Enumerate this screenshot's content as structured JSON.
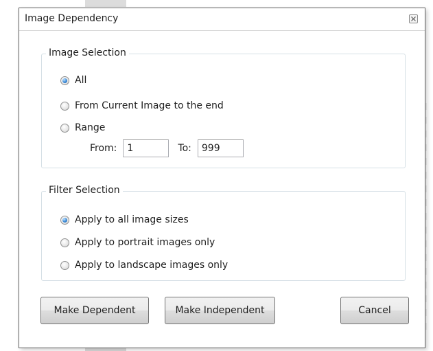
{
  "dialog": {
    "title": "Image Dependency"
  },
  "image_selection": {
    "legend": "Image Selection",
    "options": [
      {
        "label": "All",
        "checked": true
      },
      {
        "label": "From Current Image to the end",
        "checked": false
      },
      {
        "label": "Range",
        "checked": false
      }
    ],
    "range": {
      "from_label": "From:",
      "from_value": "1",
      "to_label": "To:",
      "to_value": "999"
    }
  },
  "filter_selection": {
    "legend": "Filter Selection",
    "options": [
      {
        "label": "Apply to all image sizes",
        "checked": true
      },
      {
        "label": "Apply to portrait images only",
        "checked": false
      },
      {
        "label": "Apply to landscape images only",
        "checked": false
      }
    ]
  },
  "buttons": {
    "make_dependent": "Make Dependent",
    "make_independent": "Make Independent",
    "cancel": "Cancel"
  },
  "colors": {
    "radio_selected": "#3c8ad6",
    "group_border": "#d5dfe5",
    "window_border": "#5c5c5c"
  }
}
